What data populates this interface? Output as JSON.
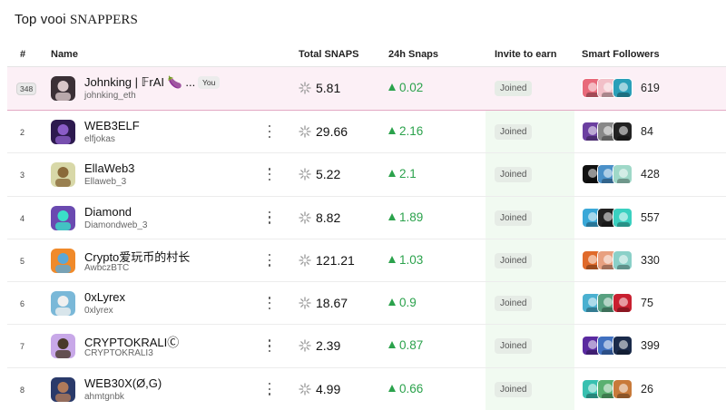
{
  "page": {
    "title_prefix": "Top vooi ",
    "title_accent": "SNAPPERS"
  },
  "columns": {
    "rank": "#",
    "name": "Name",
    "total": "Total SNAPS",
    "h24": "24h Snaps",
    "invite": "Invite to earn",
    "followers": "Smart Followers"
  },
  "colors": {
    "positive": "#2ba24c",
    "highlight_row": "#fcf0f6",
    "joined_column": "#f1faf1"
  },
  "rows": [
    {
      "rank": "348",
      "name": "Johnking | 𝔽rAI 🍆 ...",
      "handle": "johnking_eth",
      "you": "You",
      "total": "5.81",
      "change": "0.02",
      "invite": "Joined",
      "followers": "619",
      "avatar": "anime-avatar",
      "fav_colors": [
        "#e86a7a",
        "#f2c0c8",
        "#2a9fb8"
      ]
    },
    {
      "rank": "2",
      "name": "WEB3ELF",
      "handle": "elfjokas",
      "total": "29.66",
      "change": "2.16",
      "invite": "Joined",
      "followers": "84",
      "avatar": "elf-avatar",
      "fav_colors": [
        "#6b3fa0",
        "#888888",
        "#222222"
      ]
    },
    {
      "rank": "3",
      "name": "EllaWeb3",
      "handle": "Ellaweb_3",
      "total": "5.22",
      "change": "2.1",
      "invite": "Joined",
      "followers": "428",
      "avatar": "pixel-avatar",
      "fav_colors": [
        "#111111",
        "#4a90c8",
        "#9fd8c8"
      ]
    },
    {
      "rank": "4",
      "name": "Diamond",
      "handle": "Diamondweb_3",
      "total": "8.82",
      "change": "1.89",
      "invite": "Joined",
      "followers": "557",
      "avatar": "robot-avatar",
      "fav_colors": [
        "#3aa8d8",
        "#222222",
        "#3ad0c0"
      ]
    },
    {
      "rank": "5",
      "name": "Crypto爱玩币的村长",
      "handle": "AwbczBTC",
      "total": "121.21",
      "change": "1.03",
      "invite": "Joined",
      "followers": "330",
      "avatar": "dog-avatar",
      "fav_colors": [
        "#e06a2a",
        "#e8a080",
        "#8ad0c8"
      ]
    },
    {
      "rank": "6",
      "name": "0xLyrex",
      "handle": "0xlyrex",
      "total": "18.67",
      "change": "0.9",
      "invite": "Joined",
      "followers": "75",
      "avatar": "cartoon-avatar",
      "fav_colors": [
        "#4ab0d0",
        "#58a080",
        "#c82030"
      ]
    },
    {
      "rank": "7",
      "name": "CRYPTOKRALIⒸ",
      "handle": "CRYPTOKRALI3",
      "total": "2.39",
      "change": "0.87",
      "invite": "Joined",
      "followers": "399",
      "avatar": "purple-avatar",
      "fav_colors": [
        "#5a2aa0",
        "#4070c0",
        "#1a2a4a"
      ]
    },
    {
      "rank": "8",
      "name": "WEB30X(Ø,G)",
      "handle": "ahmtgnbk",
      "total": "4.99",
      "change": "0.66",
      "invite": "Joined",
      "followers": "26",
      "avatar": "photo-avatar",
      "fav_colors": [
        "#38c0b0",
        "#5ab070",
        "#c87a3a"
      ]
    }
  ]
}
